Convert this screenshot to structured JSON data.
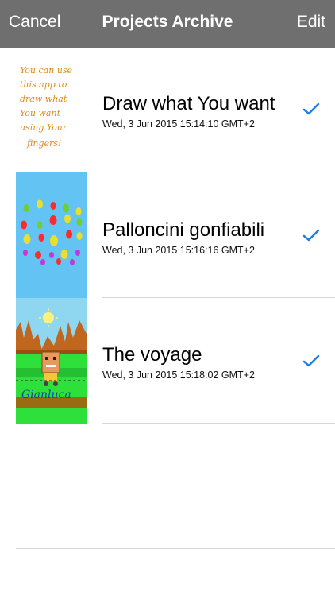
{
  "navbar": {
    "left_label": "Cancel",
    "title": "Projects Archive",
    "right_label": "Edit",
    "background": "#6f6f6f"
  },
  "projects": [
    {
      "title": "Draw what You want",
      "date": "Wed, 3 Jun 2015 15:14:10 GMT+2",
      "checked": true,
      "thumbnail_text": [
        "You can use",
        "this app to",
        "draw what",
        "You want",
        "using Your",
        "fingers!"
      ]
    },
    {
      "title": "Palloncini gonfiabili",
      "date": "Wed, 3 Jun 2015 15:16:16 GMT+2",
      "checked": true
    },
    {
      "title": "The voyage",
      "date": "Wed, 3 Jun 2015 15:18:02 GMT+2",
      "checked": true,
      "thumbnail_signature": "Gianluca"
    }
  ],
  "icons": {
    "check": "checkmark-icon"
  },
  "colors": {
    "accent": "#1f7ee0",
    "separator": "#d7d7d7"
  }
}
